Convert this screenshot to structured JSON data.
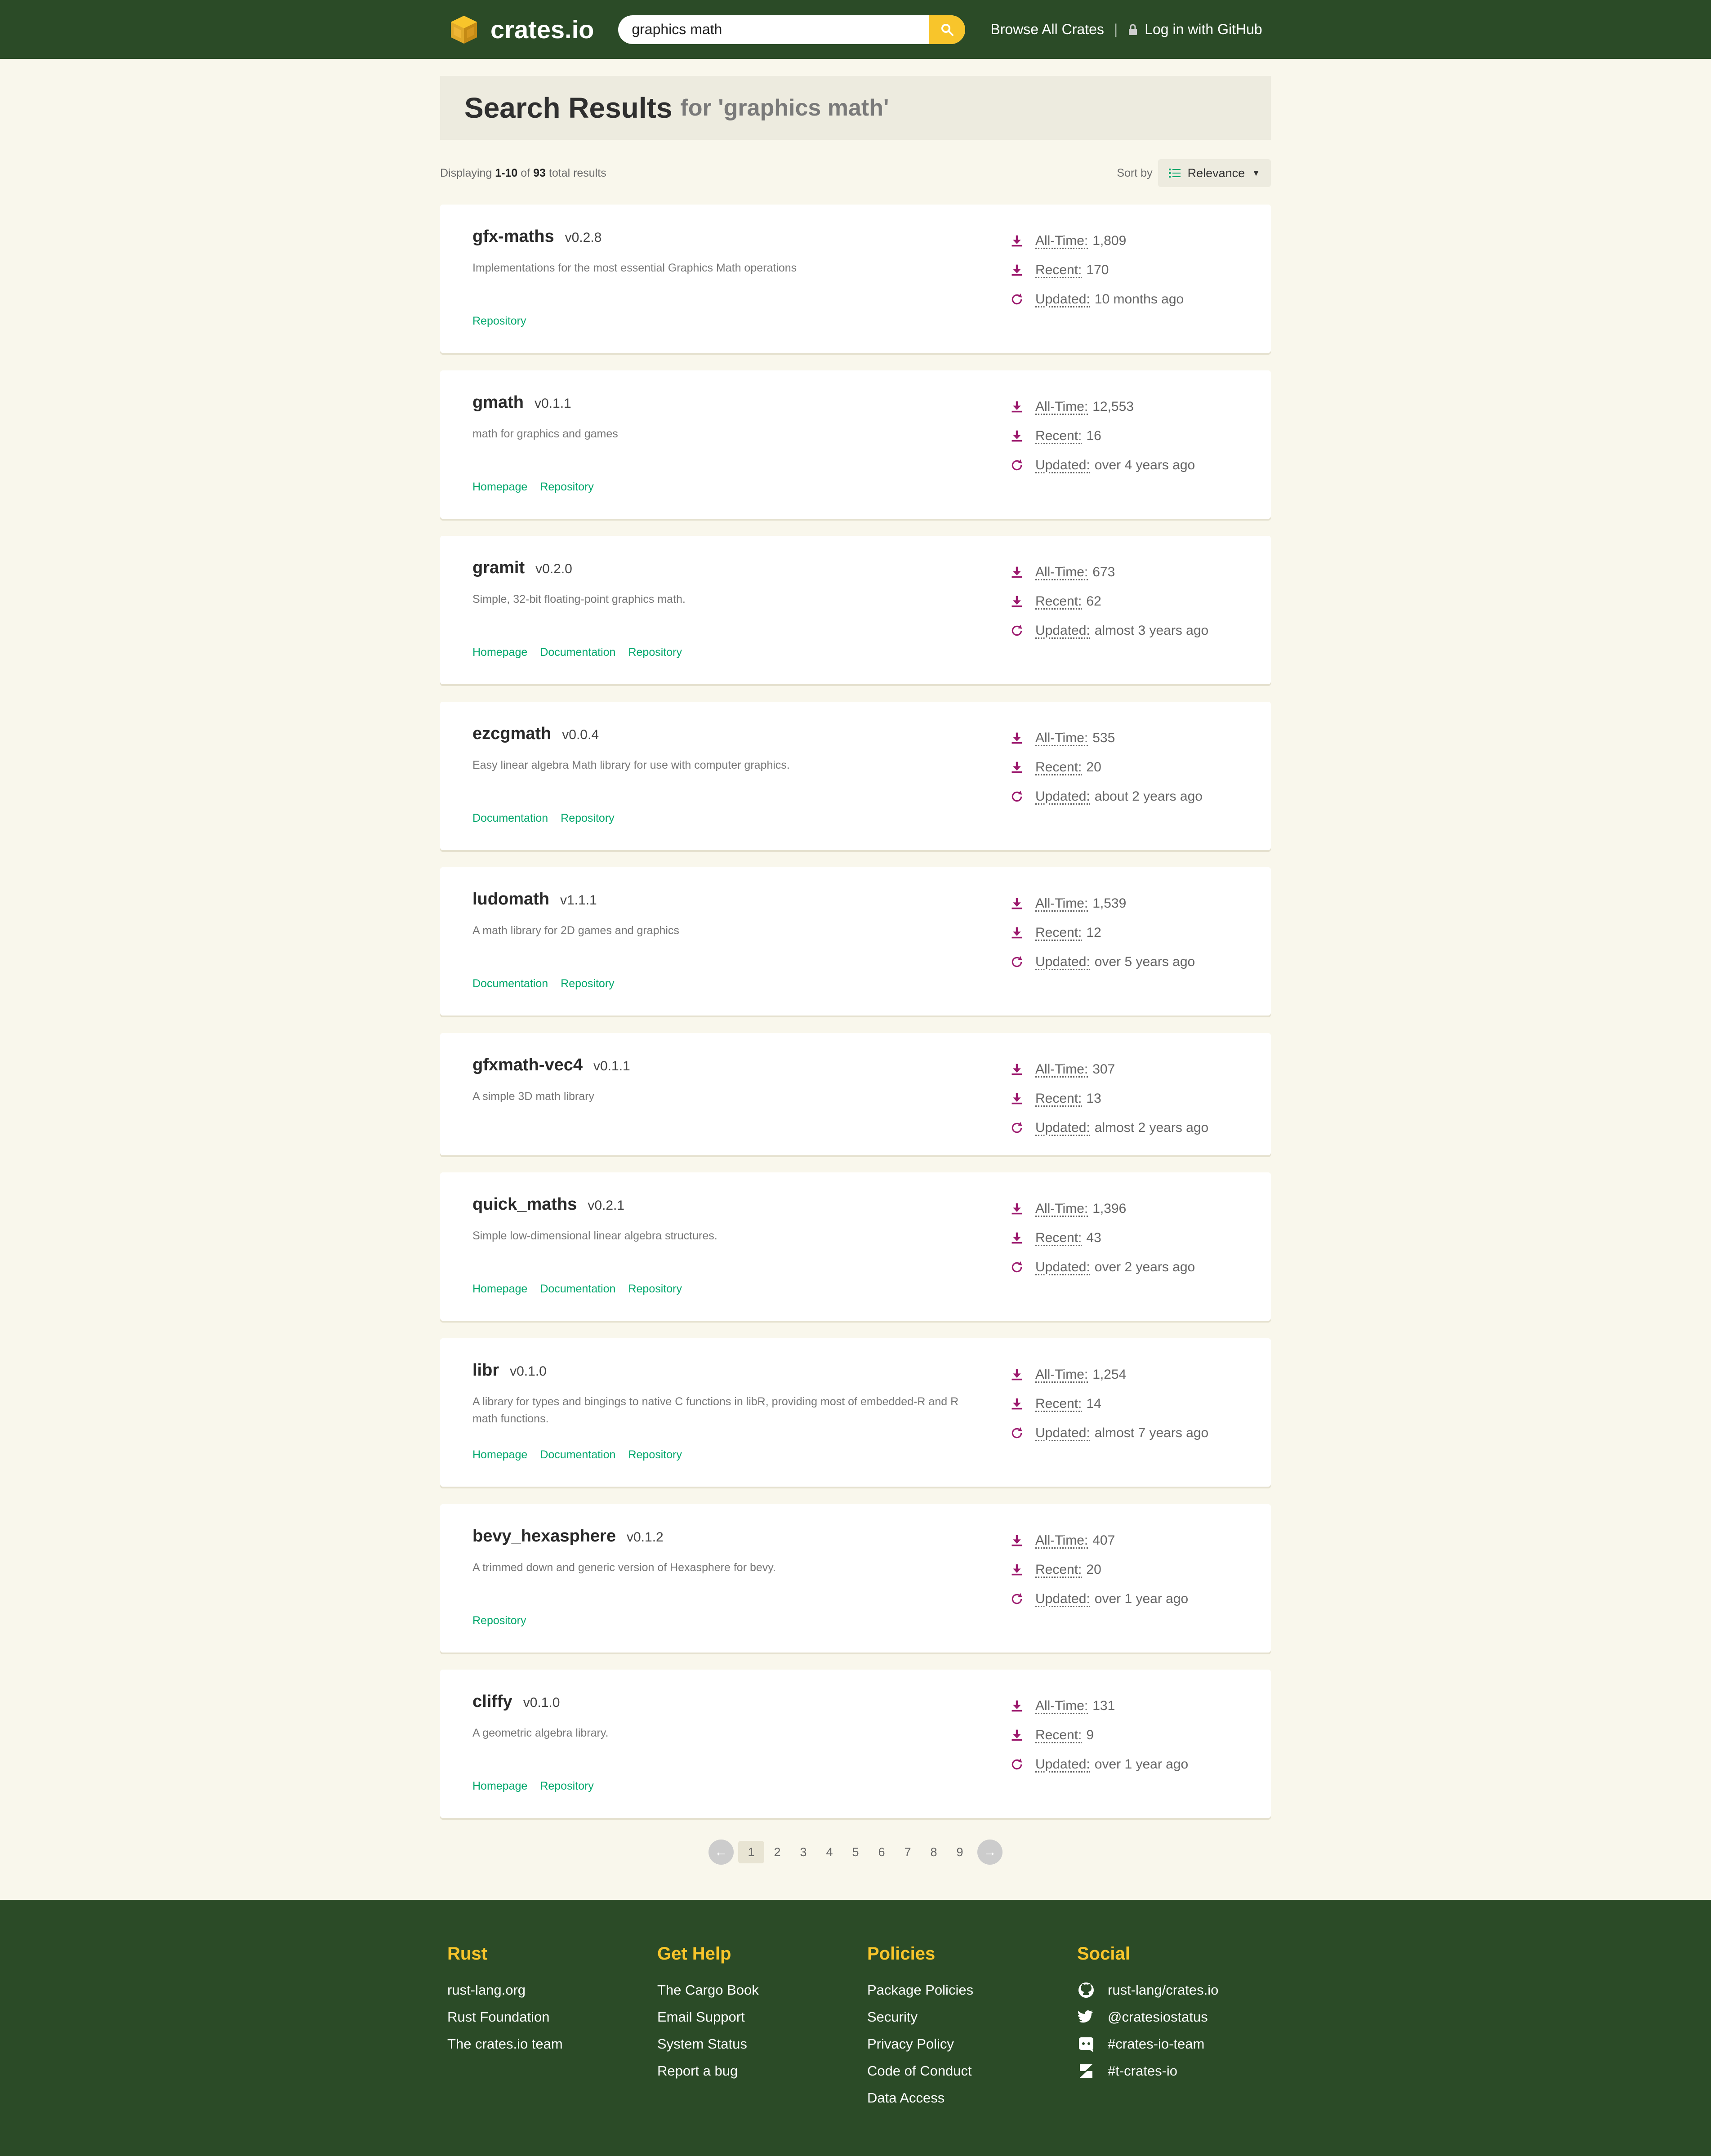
{
  "header": {
    "logo_text": "crates.io",
    "search_value": "graphics math",
    "browse_label": "Browse All Crates",
    "separator": "|",
    "login_label": "Log in with GitHub"
  },
  "hero": {
    "title": "Search Results",
    "subtitle": "for 'graphics math'"
  },
  "results_meta": {
    "prefix": "Displaying",
    "range": "1-10",
    "of": "of",
    "total": "93",
    "suffix": "total results",
    "sort_label": "Sort by",
    "sort_value": "Relevance"
  },
  "stat_labels": {
    "all_time": "All-Time:",
    "recent": "Recent:",
    "updated": "Updated:"
  },
  "crates": [
    {
      "name": "gfx-maths",
      "version": "v0.2.8",
      "description": "Implementations for the most essential Graphics Math operations",
      "links": [
        "Repository"
      ],
      "all_time": "1,809",
      "recent": "170",
      "updated": "10 months ago"
    },
    {
      "name": "gmath",
      "version": "v0.1.1",
      "description": "math for graphics and games",
      "links": [
        "Homepage",
        "Repository"
      ],
      "all_time": "12,553",
      "recent": "16",
      "updated": "over 4 years ago"
    },
    {
      "name": "gramit",
      "version": "v0.2.0",
      "description": "Simple, 32-bit floating-point graphics math.",
      "links": [
        "Homepage",
        "Documentation",
        "Repository"
      ],
      "all_time": "673",
      "recent": "62",
      "updated": "almost 3 years ago"
    },
    {
      "name": "ezcgmath",
      "version": "v0.0.4",
      "description": "Easy linear algebra Math library for use with computer graphics.",
      "links": [
        "Documentation",
        "Repository"
      ],
      "all_time": "535",
      "recent": "20",
      "updated": "about 2 years ago"
    },
    {
      "name": "ludomath",
      "version": "v1.1.1",
      "description": "A math library for 2D games and graphics",
      "links": [
        "Documentation",
        "Repository"
      ],
      "all_time": "1,539",
      "recent": "12",
      "updated": "over 5 years ago"
    },
    {
      "name": "gfxmath-vec4",
      "version": "v0.1.1",
      "description": "A simple 3D math library",
      "links": [],
      "all_time": "307",
      "recent": "13",
      "updated": "almost 2 years ago"
    },
    {
      "name": "quick_maths",
      "version": "v0.2.1",
      "description": "Simple low-dimensional linear algebra structures.",
      "links": [
        "Homepage",
        "Documentation",
        "Repository"
      ],
      "all_time": "1,396",
      "recent": "43",
      "updated": "over 2 years ago"
    },
    {
      "name": "libr",
      "version": "v0.1.0",
      "description": "A library for types and bingings to native C functions in libR, providing most of embedded-R and R math functions.",
      "links": [
        "Homepage",
        "Documentation",
        "Repository"
      ],
      "all_time": "1,254",
      "recent": "14",
      "updated": "almost 7 years ago"
    },
    {
      "name": "bevy_hexasphere",
      "version": "v0.1.2",
      "description": "A trimmed down and generic version of Hexasphere for bevy.",
      "links": [
        "Repository"
      ],
      "all_time": "407",
      "recent": "20",
      "updated": "over 1 year ago"
    },
    {
      "name": "cliffy",
      "version": "v0.1.0",
      "description": "A geometric algebra library.",
      "links": [
        "Homepage",
        "Repository"
      ],
      "all_time": "131",
      "recent": "9",
      "updated": "over 1 year ago"
    }
  ],
  "pagination": {
    "pages": [
      "1",
      "2",
      "3",
      "4",
      "5",
      "6",
      "7",
      "8",
      "9"
    ],
    "current": "1"
  },
  "footer": {
    "columns": [
      {
        "title": "Rust",
        "links": [
          "rust-lang.org",
          "Rust Foundation",
          "The crates.io team"
        ]
      },
      {
        "title": "Get Help",
        "links": [
          "The Cargo Book",
          "Email Support",
          "System Status",
          "Report a bug"
        ]
      },
      {
        "title": "Policies",
        "links": [
          "Package Policies",
          "Security",
          "Privacy Policy",
          "Code of Conduct",
          "Data Access"
        ]
      },
      {
        "title": "Social",
        "links": [
          "rust-lang/crates.io",
          "@cratesiostatus",
          "#crates-io-team",
          "#t-crates-io"
        ],
        "icons": [
          "github-icon",
          "twitter-icon",
          "discord-icon",
          "zulip-icon"
        ]
      }
    ]
  },
  "colors": {
    "header_bg": "#2b4b27",
    "accent_yellow": "#f8c52b",
    "link_green": "#00a76c",
    "stat_purple": "#9c1a6e"
  }
}
